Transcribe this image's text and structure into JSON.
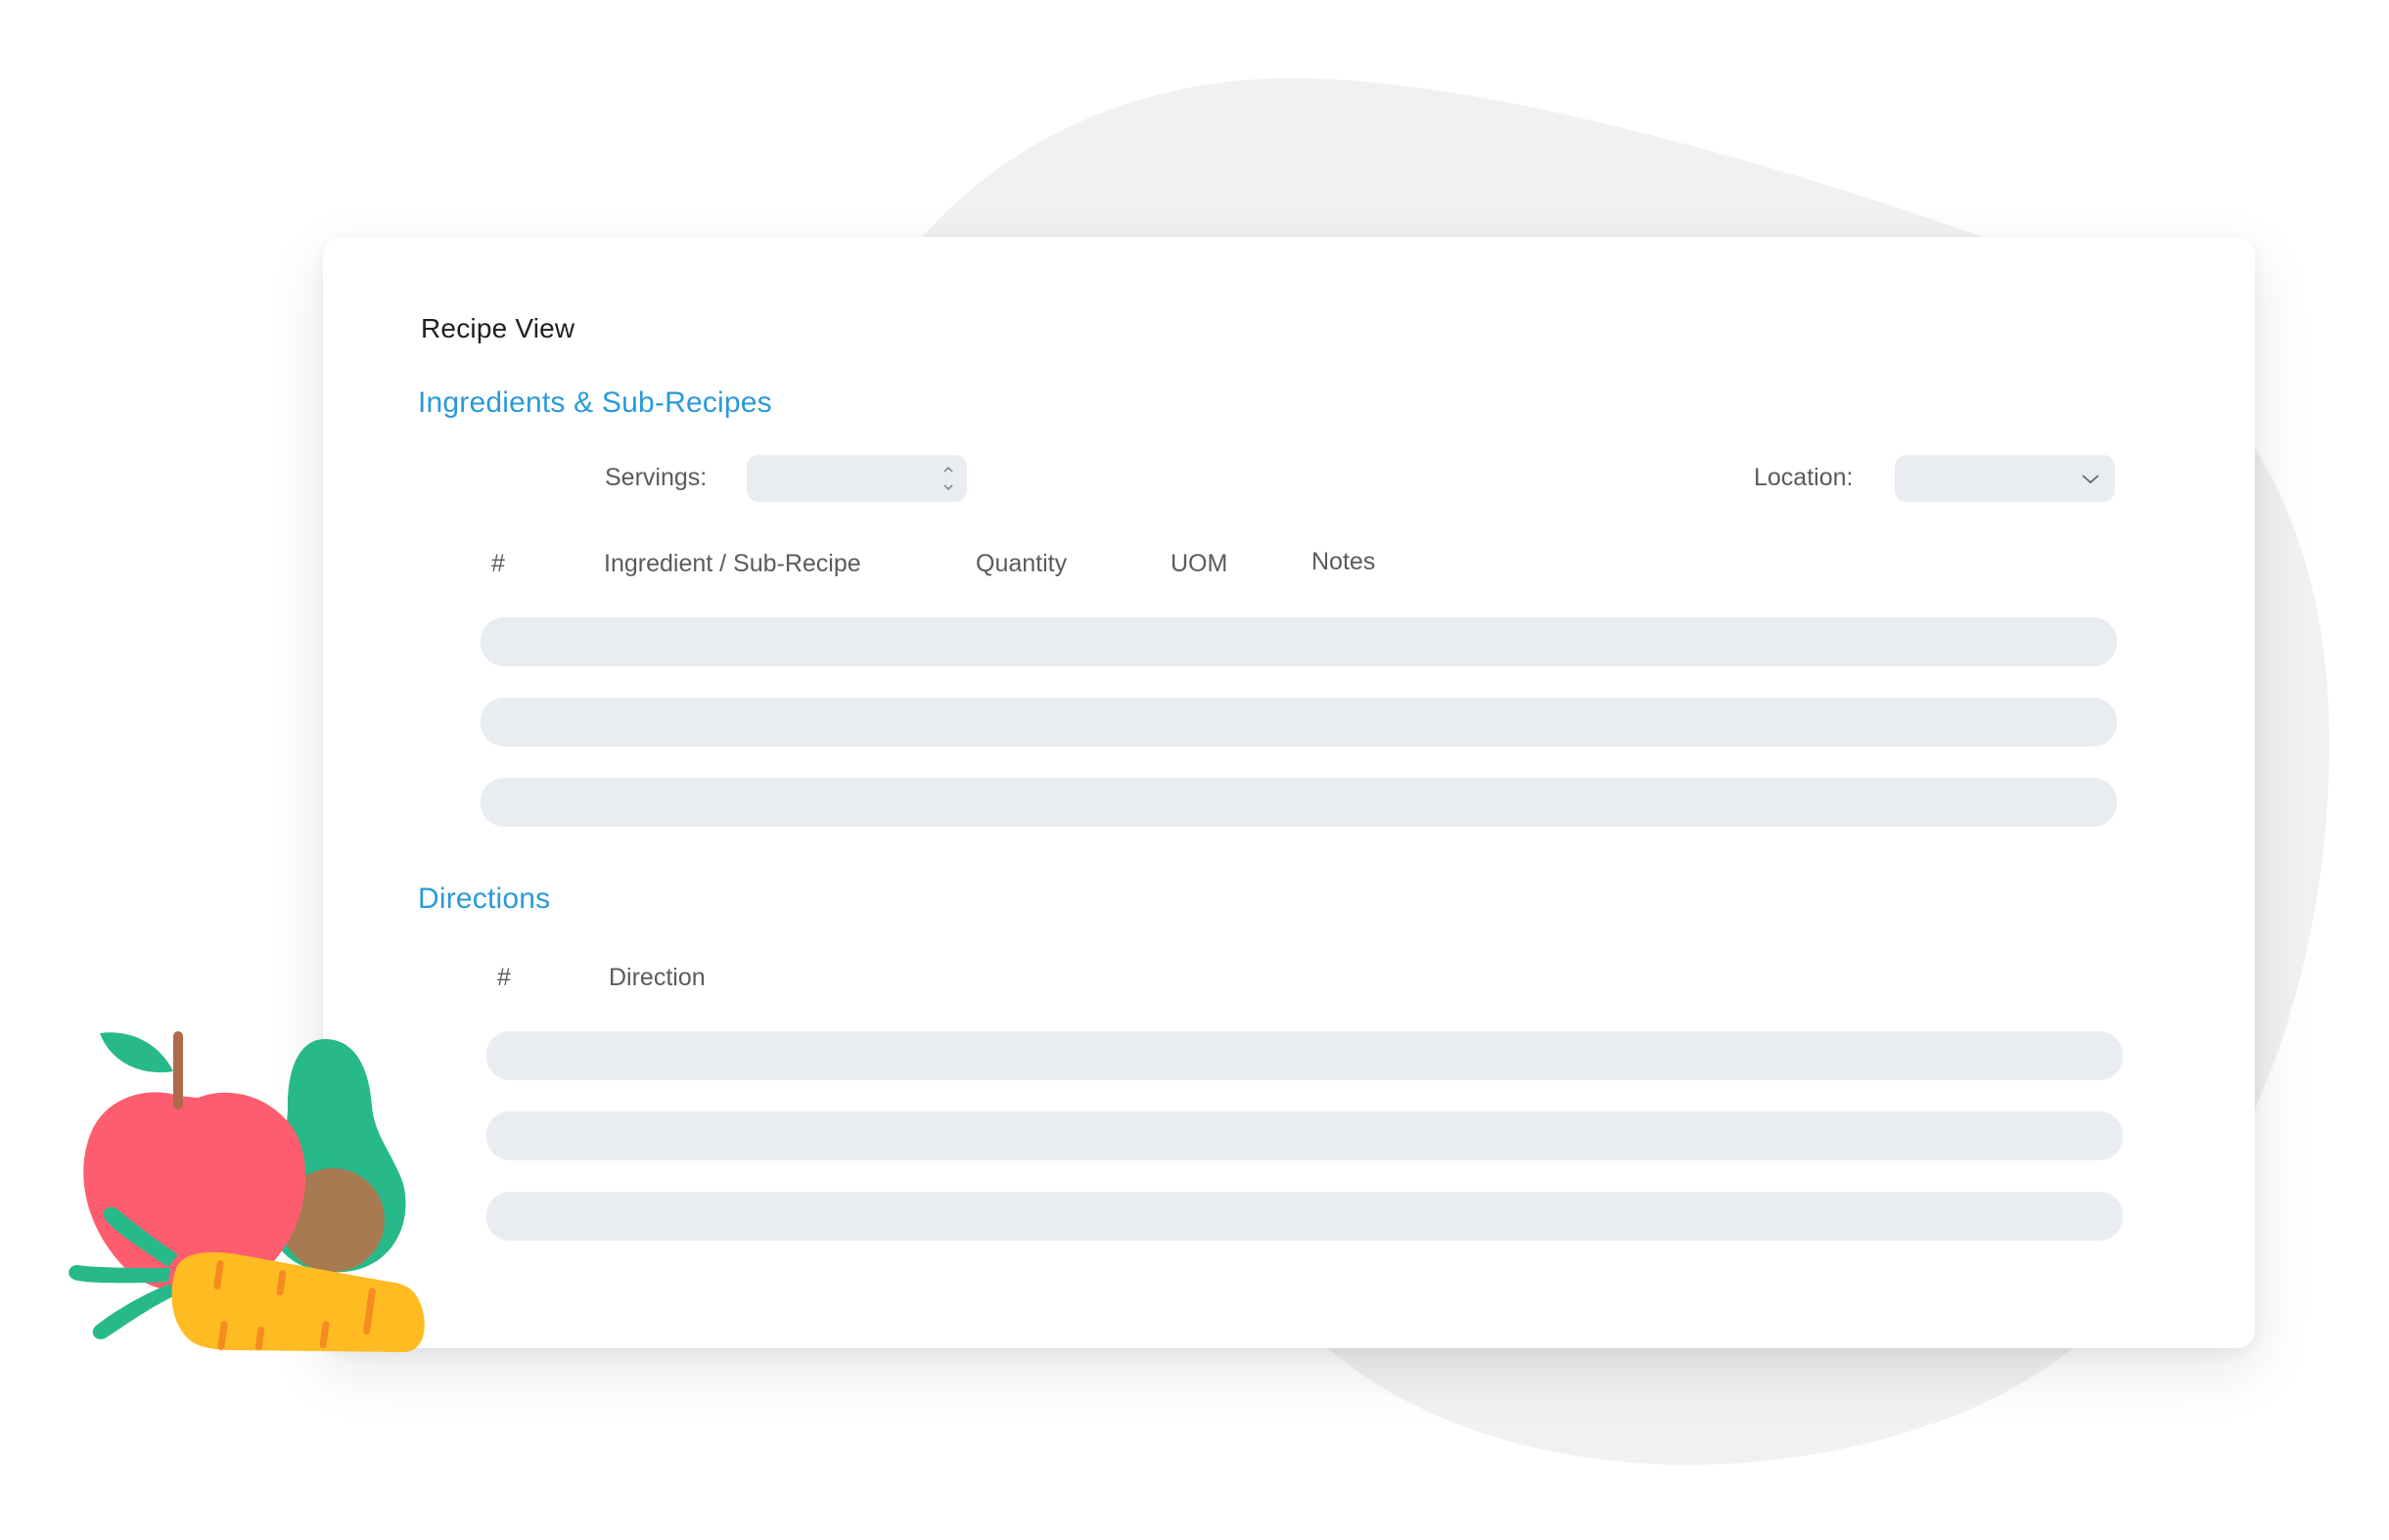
{
  "window": {
    "title": "Recipe View"
  },
  "ingredients": {
    "section_title": "Ingredients & Sub-Recipes",
    "servings_label": "Servings:",
    "servings_value": "",
    "location_label": "Location:",
    "location_value": "",
    "columns": [
      "#",
      "Ingredient / Sub-Recipe",
      "Quantity",
      "UOM",
      "Notes"
    ],
    "rows": [
      {
        "number": "",
        "ingredient": "",
        "quantity": "",
        "uom": "",
        "notes": ""
      },
      {
        "number": "",
        "ingredient": "",
        "quantity": "",
        "uom": "",
        "notes": ""
      },
      {
        "number": "",
        "ingredient": "",
        "quantity": "",
        "uom": "",
        "notes": ""
      }
    ]
  },
  "directions": {
    "section_title": "Directions",
    "columns": [
      "#",
      "Direction"
    ],
    "rows": [
      {
        "number": "",
        "direction": ""
      },
      {
        "number": "",
        "direction": ""
      },
      {
        "number": "",
        "direction": ""
      }
    ]
  },
  "illustration": {
    "icon": "fruits-vegetables-icon",
    "colors": {
      "apple": "#fe5d6f",
      "leaf": "#27b98a",
      "stem": "#b06a4a",
      "avocado": "#27b98a",
      "pit": "#a77a52",
      "carrot": "#febb22",
      "carrot_lines": "#f68b1f"
    }
  },
  "theme": {
    "accent": "#2a9ad8",
    "field_bg": "#e9edf1",
    "blob": "#f1f1f1"
  }
}
